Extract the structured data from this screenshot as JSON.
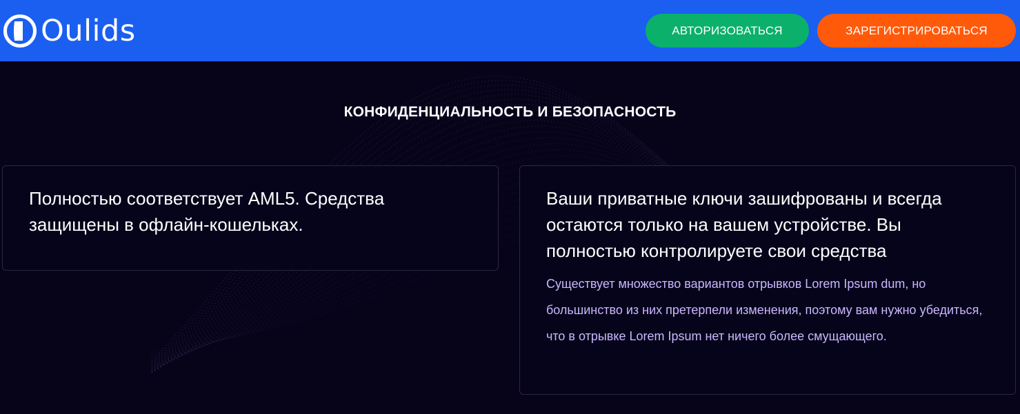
{
  "header": {
    "logo_text": "Oulids",
    "login_label": "АВТОРИЗОВАТЬСЯ",
    "register_label": "ЗАРЕГИСТРИРОВАТЬСЯ"
  },
  "section": {
    "title": "КОНФИДЕНЦИАЛЬНОСТЬ И БЕЗОПАСНОСТЬ"
  },
  "cards": [
    {
      "heading": "Полностью соответствует AML5. Средства защищены в офлайн-кошельках."
    },
    {
      "heading": "Ваши приватные ключи зашифрованы и всегда остаются только на вашем устройстве. Вы полностью контролируете свои средства",
      "text": "Существует множество вариантов отрывков Lorem Ipsum dum, но большинство из них претерпели изменения, поэтому вам нужно убедиться, что в отрывке Lorem Ipsum нет ничего более смущающего."
    }
  ],
  "colors": {
    "header_bg": "#1a5ff0",
    "page_bg": "#07041a",
    "login_button": "#0bb06b",
    "register_button": "#ff5a0a",
    "accent_text": "#c9b8ff"
  },
  "icons": {
    "logo": "ring-logo-icon"
  }
}
